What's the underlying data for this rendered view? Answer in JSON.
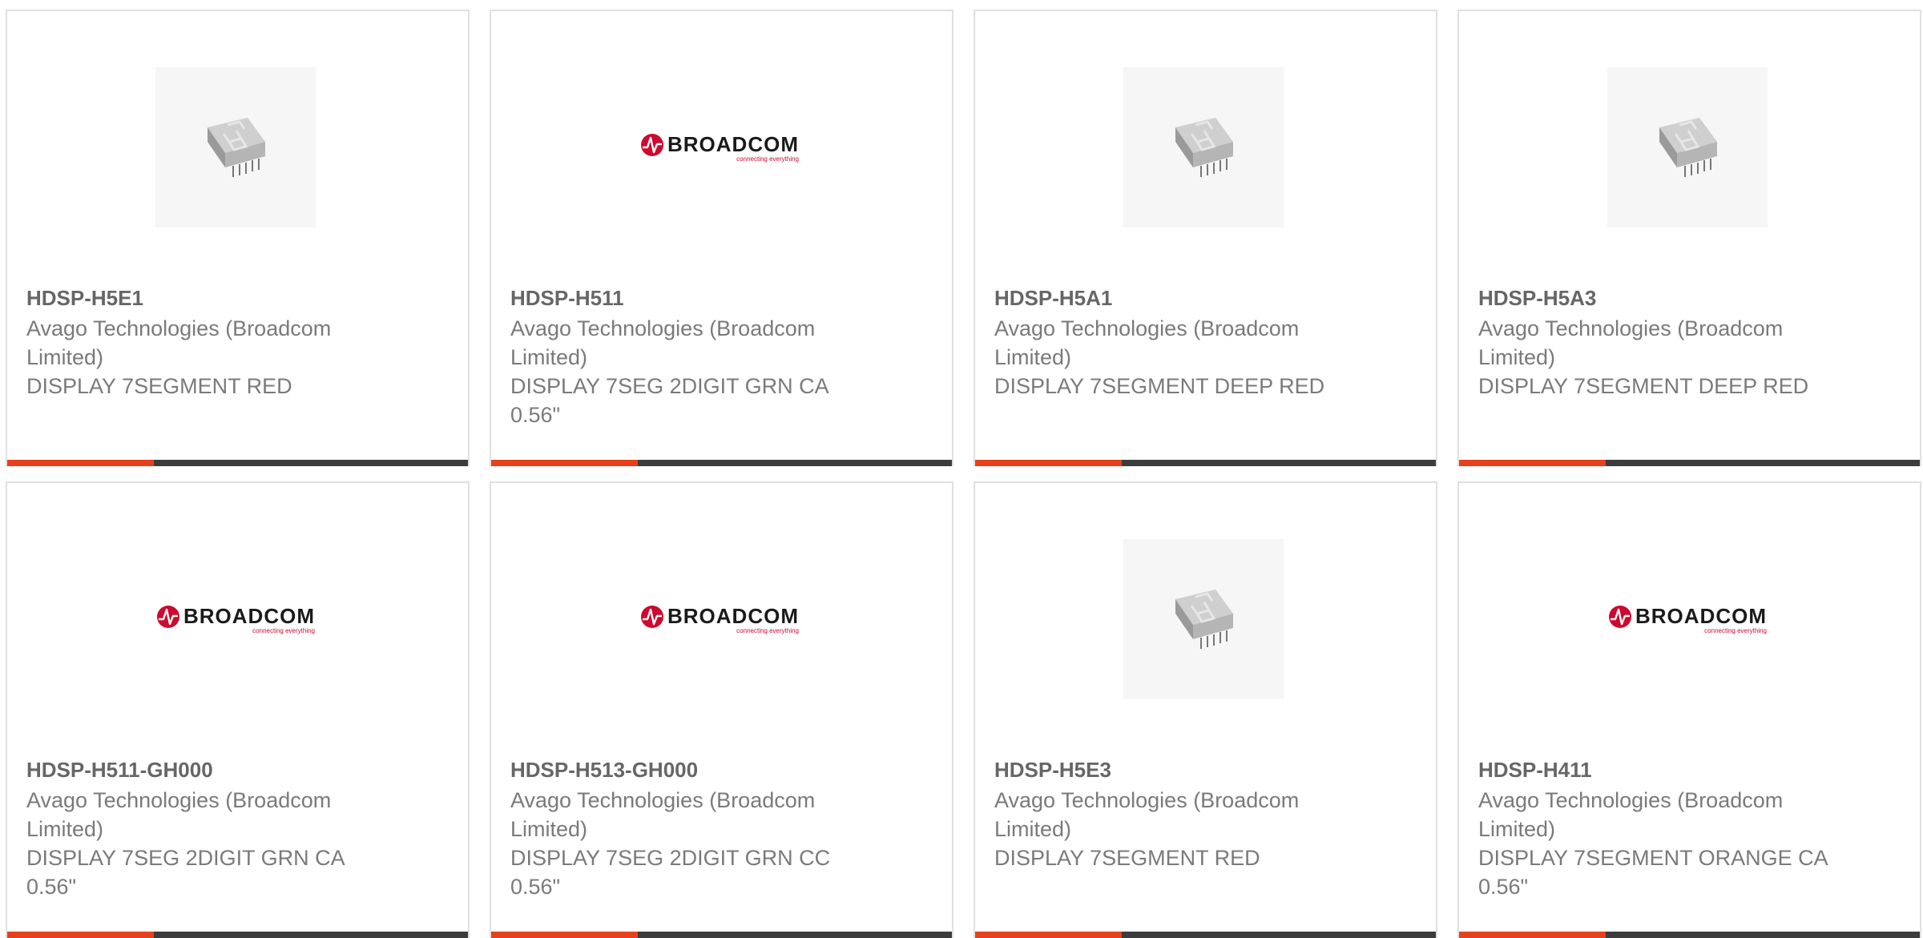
{
  "brand": {
    "logo_word": "BROADCOM",
    "logo_tagline": "connecting everything",
    "logo_color": "#cc092f",
    "accent_color": "#e8401c",
    "bar_color": "#3c3c3c"
  },
  "products": [
    {
      "part": "HDSP-H5E1",
      "manufacturer": "Avago Technologies (Broadcom Limited)",
      "description": "DISPLAY 7SEGMENT RED",
      "image": "display-photo"
    },
    {
      "part": "HDSP-H511",
      "manufacturer": "Avago Technologies (Broadcom Limited)",
      "description": "DISPLAY 7SEG 2DIGIT GRN CA 0.56\"",
      "image": "broadcom-logo"
    },
    {
      "part": "HDSP-H5A1",
      "manufacturer": "Avago Technologies (Broadcom Limited)",
      "description": "DISPLAY 7SEGMENT DEEP RED",
      "image": "display-photo"
    },
    {
      "part": "HDSP-H5A3",
      "manufacturer": "Avago Technologies (Broadcom Limited)",
      "description": "DISPLAY 7SEGMENT DEEP RED",
      "image": "display-photo"
    },
    {
      "part": "HDSP-H511-GH000",
      "manufacturer": "Avago Technologies (Broadcom Limited)",
      "description": "DISPLAY 7SEG 2DIGIT GRN CA 0.56\"",
      "image": "broadcom-logo"
    },
    {
      "part": "HDSP-H513-GH000",
      "manufacturer": "Avago Technologies (Broadcom Limited)",
      "description": "DISPLAY 7SEG 2DIGIT GRN CC 0.56\"",
      "image": "broadcom-logo"
    },
    {
      "part": "HDSP-H5E3",
      "manufacturer": "Avago Technologies (Broadcom Limited)",
      "description": "DISPLAY 7SEGMENT RED",
      "image": "display-photo"
    },
    {
      "part": "HDSP-H411",
      "manufacturer": "Avago Technologies (Broadcom Limited)",
      "description": "DISPLAY 7SEGMENT ORANGE CA 0.56\"",
      "image": "broadcom-logo"
    }
  ]
}
